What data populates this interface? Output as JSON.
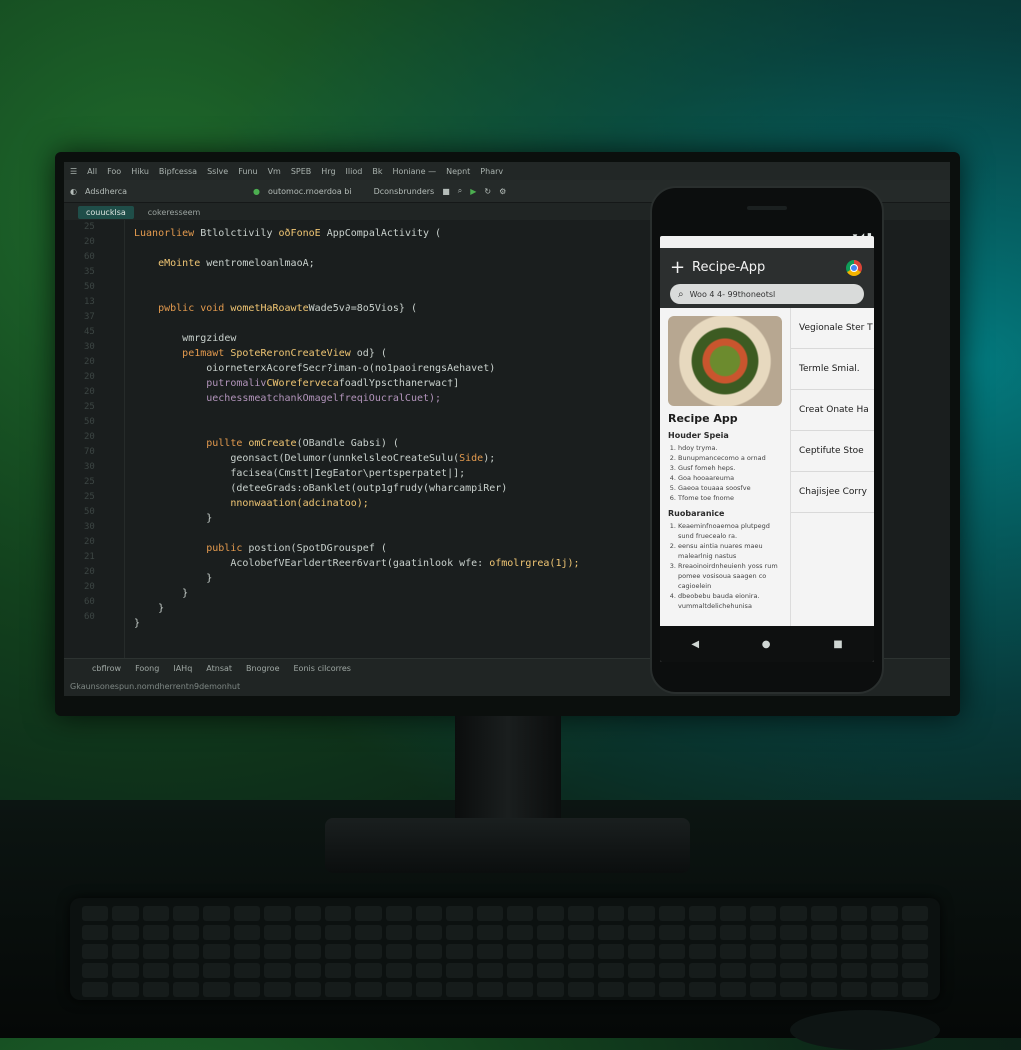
{
  "ide": {
    "menu": [
      "All",
      "Foo",
      "Hiku",
      "Bipfcessa",
      "Sslve",
      "Funu",
      "Vm",
      "SPEB",
      "Hrg",
      "Iliod",
      "Bk",
      "Honiane —",
      "Nepnt",
      "Pharv"
    ],
    "project_name": "Adsdherca",
    "run_config": "outomoc.rnoerdoa bi",
    "file_label": "Dconsbrunders",
    "tabs": [
      {
        "label": "couucklsa",
        "active": true
      },
      {
        "label": "cokeresseem",
        "active": false
      }
    ],
    "line_numbers": [
      "25",
      "20",
      "60",
      "35",
      "50",
      "13",
      "37",
      "45",
      "30",
      "20",
      "20",
      "20",
      "25",
      "50",
      "20",
      "70",
      "30",
      "25",
      "25",
      "50",
      "30",
      "20",
      "21",
      "20",
      "20",
      "60",
      "60"
    ],
    "code_lines": [
      {
        "indent": 0,
        "parts": [
          {
            "t": "Luanorliew ",
            "c": "kw"
          },
          {
            "t": "Btlolctivily ",
            "c": "st"
          },
          {
            "t": "oðFonoE ",
            "c": "fn"
          },
          {
            "t": "AppCompalActivity (",
            "c": "st"
          }
        ]
      },
      {
        "indent": 0,
        "parts": []
      },
      {
        "indent": 1,
        "parts": [
          {
            "t": "eMointe ",
            "c": "fn"
          },
          {
            "t": "wentromeloanlmaoA;",
            "c": "st"
          }
        ]
      },
      {
        "indent": 0,
        "parts": []
      },
      {
        "indent": 0,
        "parts": []
      },
      {
        "indent": 1,
        "parts": [
          {
            "t": "pwblic void ",
            "c": "kw"
          },
          {
            "t": "wometHaRoawte",
            "c": "fn"
          },
          {
            "t": "Wade5v∂=8o5Vios} (",
            "c": "st"
          }
        ]
      },
      {
        "indent": 0,
        "parts": []
      },
      {
        "indent": 2,
        "parts": [
          {
            "t": "wmrgzidew",
            "c": "st"
          }
        ]
      },
      {
        "indent": 2,
        "parts": [
          {
            "t": "pe1mawt ",
            "c": "kw"
          },
          {
            "t": "SpoteReronCreateView ",
            "c": "fn"
          },
          {
            "t": "od} (",
            "c": "st"
          }
        ]
      },
      {
        "indent": 3,
        "parts": [
          {
            "t": "oiorneterxAcorefSecr?iman-o(no1paoirengsAehavet)",
            "c": "st"
          }
        ]
      },
      {
        "indent": 3,
        "parts": [
          {
            "t": "putromaliv",
            "c": "vr"
          },
          {
            "t": "CWoreferveca",
            "c": "fn"
          },
          {
            "t": "foadlYpscthanerwac†]",
            "c": "st"
          }
        ]
      },
      {
        "indent": 3,
        "parts": [
          {
            "t": "uechessmeatchankOmagelfreqiOucralCuet);",
            "c": "vr"
          }
        ]
      },
      {
        "indent": 0,
        "parts": []
      },
      {
        "indent": 0,
        "parts": []
      },
      {
        "indent": 3,
        "parts": [
          {
            "t": "pullte ",
            "c": "kw"
          },
          {
            "t": "omCreate",
            "c": "fn"
          },
          {
            "t": "(OBandle Gabsi) (",
            "c": "st"
          }
        ]
      },
      {
        "indent": 4,
        "parts": [
          {
            "t": "geonsact(Delumor(unnkelsleoCreateSulu(",
            "c": "st"
          },
          {
            "t": "Side",
            "c": "kw"
          },
          {
            "t": ");",
            "c": "st"
          }
        ]
      },
      {
        "indent": 4,
        "parts": [
          {
            "t": "facisea(Cmstt|IegEator\\pertsperpatet|];",
            "c": "st"
          }
        ]
      },
      {
        "indent": 4,
        "parts": [
          {
            "t": "(deteeGrads:oBanklet(outp1gfrudy(wharcampiRer)",
            "c": "st"
          }
        ]
      },
      {
        "indent": 4,
        "parts": [
          {
            "t": "nnonwaation(adcinatoo);",
            "c": "fn"
          }
        ]
      },
      {
        "indent": 3,
        "parts": [
          {
            "t": "}",
            "c": "st"
          }
        ]
      },
      {
        "indent": 0,
        "parts": []
      },
      {
        "indent": 3,
        "parts": [
          {
            "t": "public ",
            "c": "kw"
          },
          {
            "t": "postion(SpotDGrouspef (",
            "c": "st"
          }
        ]
      },
      {
        "indent": 4,
        "parts": [
          {
            "t": "AcolobefVEarldertReer6vart(gaatinlook wfe: ",
            "c": "st"
          },
          {
            "t": "ofmolrgrea(1j);",
            "c": "fn"
          }
        ]
      },
      {
        "indent": 3,
        "parts": [
          {
            "t": "}",
            "c": "st"
          }
        ]
      },
      {
        "indent": 2,
        "parts": [
          {
            "t": "}",
            "c": "st"
          }
        ]
      },
      {
        "indent": 1,
        "parts": [
          {
            "t": "}",
            "c": "st"
          }
        ]
      },
      {
        "indent": 0,
        "parts": [
          {
            "t": "}",
            "c": "st"
          }
        ]
      }
    ],
    "bottom_tabs": [
      "cbflrow",
      "Foong",
      "IAHq",
      "Atnsat",
      "Bnogroe",
      "Eonis cilcorres"
    ],
    "status_text": "Gkaunsonespun.nomdherrentn9demonhut"
  },
  "phone": {
    "app_title": "Recipe-App",
    "search_placeholder": "Woo 4 4- 99thoneotsl",
    "recipe_title": "Recipe App",
    "section1_heading": "Houder Speia",
    "section1_items": [
      "hdoy tryma.",
      "Bunupmancecomo a ornad",
      "Gusf fomeh heps.",
      "Goa hooaareuma",
      "Gaeoa touaaa soosfve",
      "Tfome toe fnome"
    ],
    "section2_heading": "Ruobaranice",
    "section2_items": [
      "Keaeminfnoaemoa plutpegd sund fruecealo ra.",
      "eensu aintia nuares maeu malearlnig nastus",
      "Rreaoinoirdnheuienh yoss rum pomee vosisoua saagen co cagioelein",
      "dbeobebu bauda eionira. vummaltdelichehunisa"
    ],
    "side_items": [
      "Vegionale Ster T",
      "Termle Smial.",
      "Creat Onate Ha",
      "Ceptifute Stoe",
      "Chajisjee Corry"
    ]
  }
}
